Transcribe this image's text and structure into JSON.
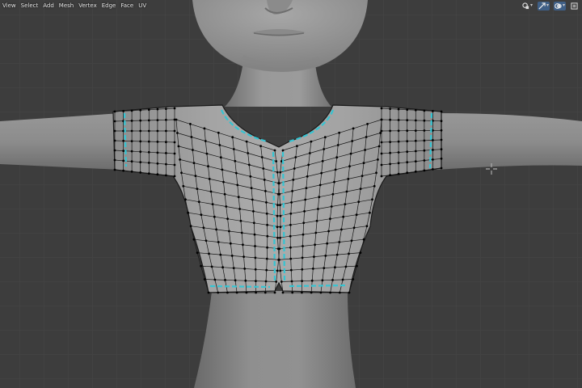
{
  "menu": {
    "items": [
      {
        "label": "View"
      },
      {
        "label": "Select"
      },
      {
        "label": "Add"
      },
      {
        "label": "Mesh"
      },
      {
        "label": "Vertex"
      },
      {
        "label": "Edge"
      },
      {
        "label": "Face"
      },
      {
        "label": "UV"
      }
    ]
  },
  "toolbar": {
    "icons": [
      "view-object-types-icon",
      "gizmo-toggle-icon",
      "overlays-icon",
      "xray-toggle-icon"
    ]
  },
  "colors": {
    "background": "#3d3d3d",
    "grid": "#484848",
    "mesh_edge": "#111111",
    "seam": "#35c4d2",
    "vertex": "#000000"
  },
  "cursor": "crosshair-icon"
}
